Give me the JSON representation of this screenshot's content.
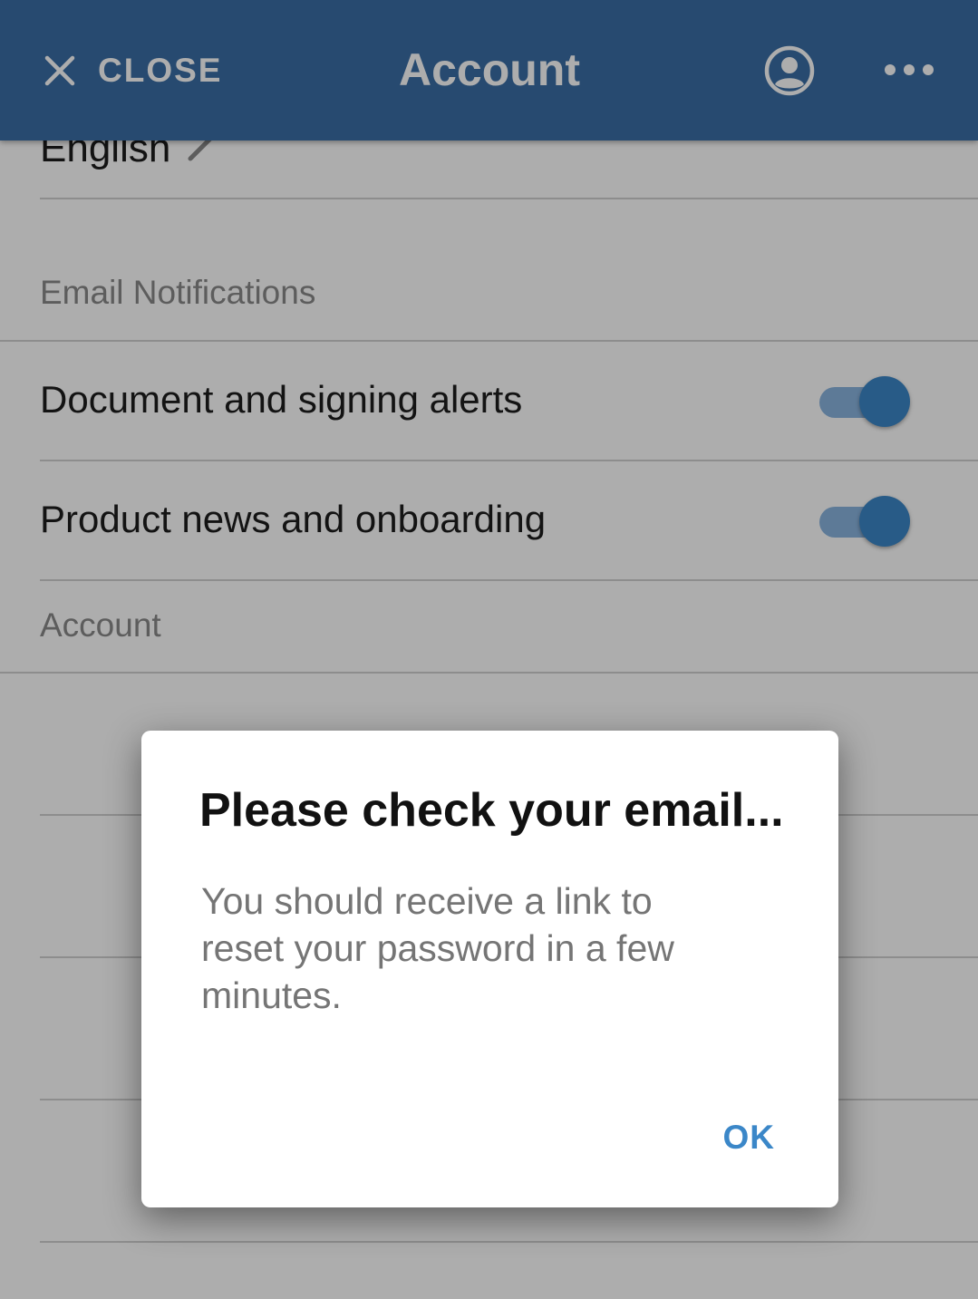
{
  "appbar": {
    "close_label": "CLOSE",
    "title": "Account"
  },
  "settings": {
    "language_value": "English",
    "email_section_header": "Email Notifications",
    "rows": [
      {
        "label": "Document and signing alerts",
        "enabled": true
      },
      {
        "label": "Product news and onboarding",
        "enabled": true
      }
    ],
    "account_section_header": "Account"
  },
  "dialog": {
    "title": "Please check your email...",
    "message": "You should receive a link to reset your password in a few minutes.",
    "ok_label": "OK"
  },
  "colors": {
    "appbar": "#3a6ea5",
    "accent": "#3b87c8"
  }
}
